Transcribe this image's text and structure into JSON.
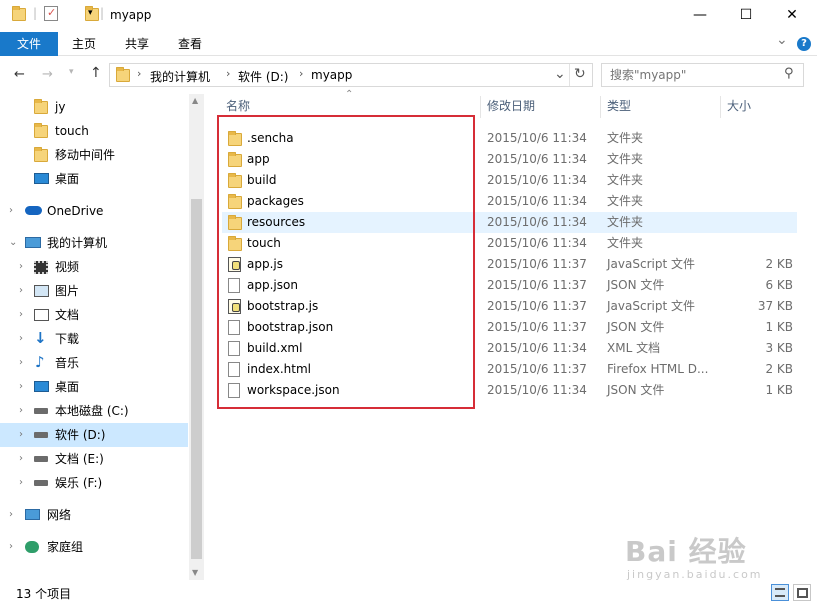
{
  "window": {
    "title": "myapp",
    "minimize_glyph": "—",
    "maximize_glyph": "☐",
    "close_glyph": "✕"
  },
  "ribbon": {
    "tabs": [
      "文件",
      "主页",
      "共享",
      "查看"
    ],
    "expand_glyph": "⌄",
    "help_glyph": "?"
  },
  "address": {
    "crumbs": [
      "我的计算机",
      "软件 (D:)",
      "myapp"
    ],
    "refresh_glyph": "↻"
  },
  "search": {
    "placeholder": "搜索\"myapp\""
  },
  "sidebar": {
    "items": [
      {
        "label": "jy",
        "icon": "folder-icon"
      },
      {
        "label": "touch",
        "icon": "folder-icon"
      },
      {
        "label": "移动中间件",
        "icon": "folder-icon"
      },
      {
        "label": "桌面",
        "icon": "desktop-icon"
      },
      {
        "label": "OneDrive",
        "icon": "cloud-icon"
      },
      {
        "label": "我的计算机",
        "icon": "computer-icon"
      },
      {
        "label": "视频",
        "icon": "video-icon"
      },
      {
        "label": "图片",
        "icon": "picture-icon"
      },
      {
        "label": "文档",
        "icon": "document-icon"
      },
      {
        "label": "下载",
        "icon": "download-icon"
      },
      {
        "label": "音乐",
        "icon": "music-icon"
      },
      {
        "label": "桌面",
        "icon": "desktop-icon"
      },
      {
        "label": "本地磁盘 (C:)",
        "icon": "drive-icon"
      },
      {
        "label": "软件 (D:)",
        "icon": "drive-icon"
      },
      {
        "label": "文档 (E:)",
        "icon": "drive-icon"
      },
      {
        "label": "娱乐 (F:)",
        "icon": "drive-icon"
      },
      {
        "label": "网络",
        "icon": "network-icon"
      },
      {
        "label": "家庭组",
        "icon": "homegroup-icon"
      }
    ]
  },
  "columns": {
    "name": "名称",
    "date": "修改日期",
    "type": "类型",
    "size": "大小"
  },
  "files": [
    {
      "name": ".sencha",
      "date": "2015/10/6 11:34",
      "type": "文件夹",
      "size": "",
      "kind": "folder"
    },
    {
      "name": "app",
      "date": "2015/10/6 11:34",
      "type": "文件夹",
      "size": "",
      "kind": "folder"
    },
    {
      "name": "build",
      "date": "2015/10/6 11:34",
      "type": "文件夹",
      "size": "",
      "kind": "folder"
    },
    {
      "name": "packages",
      "date": "2015/10/6 11:34",
      "type": "文件夹",
      "size": "",
      "kind": "folder"
    },
    {
      "name": "resources",
      "date": "2015/10/6 11:34",
      "type": "文件夹",
      "size": "",
      "kind": "folder"
    },
    {
      "name": "touch",
      "date": "2015/10/6 11:34",
      "type": "文件夹",
      "size": "",
      "kind": "folder"
    },
    {
      "name": "app.js",
      "date": "2015/10/6 11:37",
      "type": "JavaScript 文件",
      "size": "2 KB",
      "kind": "js"
    },
    {
      "name": "app.json",
      "date": "2015/10/6 11:37",
      "type": "JSON 文件",
      "size": "6 KB",
      "kind": "file"
    },
    {
      "name": "bootstrap.js",
      "date": "2015/10/6 11:37",
      "type": "JavaScript 文件",
      "size": "37 KB",
      "kind": "js"
    },
    {
      "name": "bootstrap.json",
      "date": "2015/10/6 11:37",
      "type": "JSON 文件",
      "size": "1 KB",
      "kind": "file"
    },
    {
      "name": "build.xml",
      "date": "2015/10/6 11:34",
      "type": "XML 文档",
      "size": "3 KB",
      "kind": "file"
    },
    {
      "name": "index.html",
      "date": "2015/10/6 11:37",
      "type": "Firefox HTML D...",
      "size": "2 KB",
      "kind": "file"
    },
    {
      "name": "workspace.json",
      "date": "2015/10/6 11:34",
      "type": "JSON 文件",
      "size": "1 KB",
      "kind": "file"
    }
  ],
  "status": {
    "count": "13 个项目"
  },
  "watermark": {
    "big": "Bai 经验",
    "small": "jingyan.baidu.com"
  },
  "colors": {
    "accent": "#1979ca",
    "selection": "#cce8ff",
    "highlight": "#d62d37"
  }
}
